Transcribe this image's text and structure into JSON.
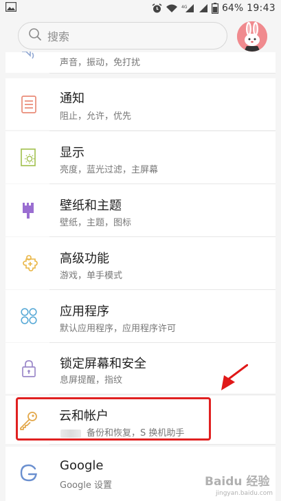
{
  "status_bar": {
    "battery": "64%",
    "time": "19:43"
  },
  "search": {
    "placeholder": "搜索"
  },
  "items": [
    {
      "title": "",
      "subtitle": "声音，振动，免打扰",
      "icon": "speaker-icon"
    },
    {
      "title": "通知",
      "subtitle": "阻止，允许，优先",
      "icon": "notification-icon"
    },
    {
      "title": "显示",
      "subtitle": "亮度，蓝光过滤，主屏幕",
      "icon": "display-brightness-icon"
    },
    {
      "title": "壁纸和主题",
      "subtitle": "壁纸，主题，图标",
      "icon": "paintbrush-icon"
    },
    {
      "title": "高级功能",
      "subtitle": "游戏，单手模式",
      "icon": "advanced-features-icon"
    },
    {
      "title": "应用程序",
      "subtitle": "默认应用程序，应用程序许可",
      "icon": "apps-icon"
    },
    {
      "title": "锁定屏幕和安全",
      "subtitle": "息屏提醒，指纹",
      "icon": "lock-icon"
    },
    {
      "title": "云和帐户",
      "subtitle": "备份和恢复，S 换机助手",
      "icon": "key-icon"
    },
    {
      "title": "Google",
      "subtitle": "Google 设置",
      "icon": "google-icon"
    }
  ],
  "colors": {
    "accent": "#e98b43",
    "highlight": "#e02020",
    "avatar": "#f08a8e"
  },
  "watermark": {
    "brand": "Baidu 经验",
    "url": "jingyan.baidu.com"
  }
}
